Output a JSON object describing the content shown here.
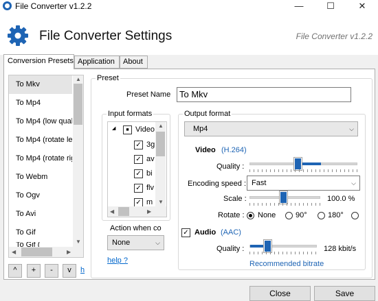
{
  "window": {
    "title": "File Converter v1.2.2",
    "minimize_glyph": "—",
    "maximize_glyph": "☐",
    "close_glyph": "✕"
  },
  "header": {
    "title": "File Converter Settings",
    "version": "File Converter v1.2.2",
    "icon": "gear-icon",
    "accent_color": "#1e64b4"
  },
  "tabs": [
    {
      "label": "Conversion Presets",
      "active": true
    },
    {
      "label": "Application",
      "active": false
    },
    {
      "label": "About",
      "active": false
    }
  ],
  "presets": {
    "items": [
      {
        "label": "To Mkv",
        "selected": true
      },
      {
        "label": "To Mp4"
      },
      {
        "label": "To Mp4 (low qual"
      },
      {
        "label": "To Mp4 (rotate le"
      },
      {
        "label": "To Mp4 (rotate rig"
      },
      {
        "label": "To Webm"
      },
      {
        "label": "To Ogv"
      },
      {
        "label": "To Avi"
      },
      {
        "label": "To Gif"
      },
      {
        "label": "To Gif ("
      }
    ],
    "buttons": [
      "^",
      "+",
      "-",
      "v"
    ],
    "help_fragment": "h"
  },
  "preset": {
    "group_label": "Preset",
    "name_label": "Preset Name",
    "name_value": "To Mkv",
    "input_formats_label": "Input formats",
    "input_formats": {
      "root": "Video",
      "items": [
        "3g",
        "av",
        "bi",
        "flv",
        "m"
      ]
    },
    "action_label": "Action when co",
    "action_value": "None",
    "help_link": "help ?"
  },
  "output": {
    "group_label": "Output format",
    "format_value": "Mp4",
    "video": {
      "label": "Video",
      "codec": "(H.264)",
      "quality_label": "Quality :",
      "quality_level": 0.45,
      "encoding_speed_label": "Encoding speed :",
      "encoding_speed_value": "Fast",
      "scale_label": "Scale :",
      "scale_value": "100.0 %",
      "scale_level": 0.45,
      "rotate_label": "Rotate :",
      "rotate_options": [
        "None",
        "90°",
        "180°",
        ""
      ],
      "rotate_selected": "None"
    },
    "audio": {
      "label": "Audio",
      "codec": "(AAC)",
      "enabled": true,
      "quality_label": "Quality :",
      "bitrate_value": "128 kbit/s",
      "bitrate_level": 0.2,
      "recommended_label": "Recommended bitrate"
    }
  },
  "footer": {
    "close_label": "Close",
    "save_label": "Save"
  }
}
